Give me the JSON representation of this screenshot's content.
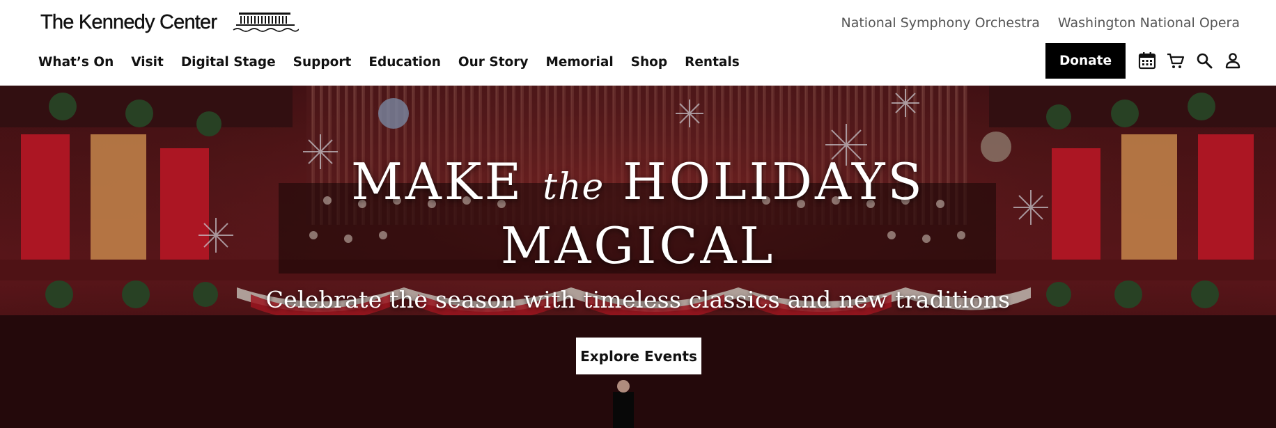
{
  "brand": {
    "name": "The Kennedy Center"
  },
  "utility_links": [
    "National Symphony Orchestra",
    "Washington National Opera"
  ],
  "nav": [
    "What’s On",
    "Visit",
    "Digital Stage",
    "Support",
    "Education",
    "Our Story",
    "Memorial",
    "Shop",
    "Rentals"
  ],
  "donate_label": "Donate",
  "icons": [
    "calendar-icon",
    "cart-icon",
    "search-icon",
    "account-icon"
  ],
  "hero": {
    "headline_part1": "MAKE",
    "headline_the": "the",
    "headline_part2": "HOLIDAYS",
    "headline_line2": "MAGICAL",
    "subheading": "Celebrate the season with timeless classics and new traditions",
    "cta_label": "Explore Events"
  },
  "colors": {
    "hero_red": "#c0182a",
    "black": "#000000",
    "white": "#ffffff"
  }
}
